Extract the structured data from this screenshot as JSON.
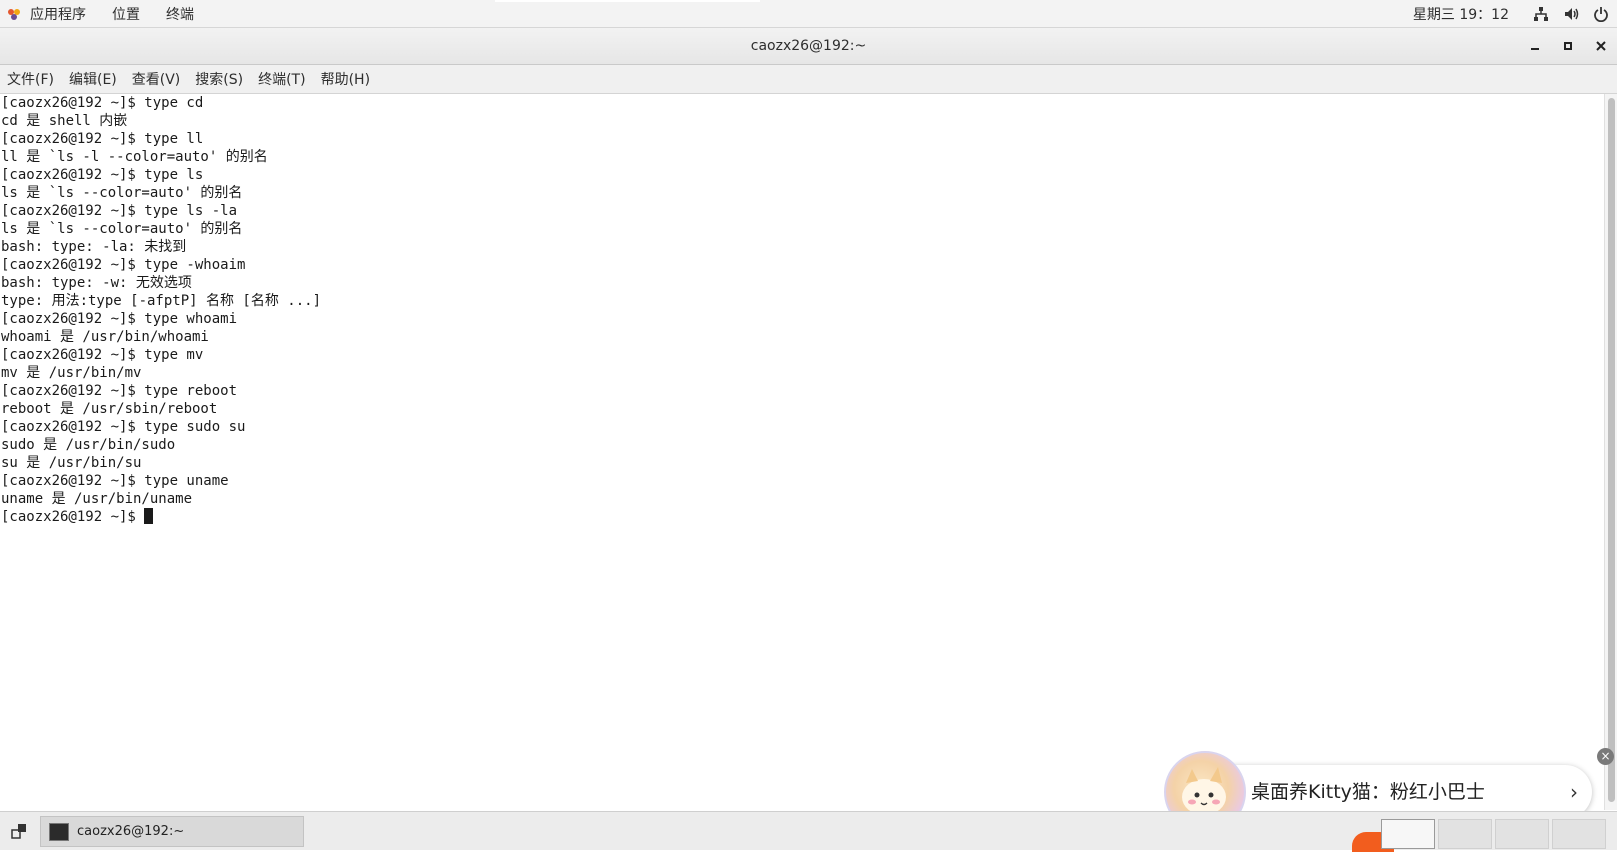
{
  "topbar": {
    "apps_label": "应用程序",
    "places_label": "位置",
    "terminal_label": "终端",
    "clock": "星期三 19：12",
    "icons": [
      "network-icon",
      "volume-icon",
      "power-icon"
    ]
  },
  "window": {
    "title": "caozx26@192:~"
  },
  "menubar": {
    "items": [
      "文件(F)",
      "编辑(E)",
      "查看(V)",
      "搜索(S)",
      "终端(T)",
      "帮助(H)"
    ]
  },
  "terminal": {
    "lines": [
      "[caozx26@192 ~]$ type cd",
      "cd 是 shell 内嵌",
      "[caozx26@192 ~]$ type ll",
      "ll 是 `ls -l --color=auto' 的别名",
      "[caozx26@192 ~]$ type ls",
      "ls 是 `ls --color=auto' 的别名",
      "[caozx26@192 ~]$ type ls -la",
      "ls 是 `ls --color=auto' 的别名",
      "bash: type: -la: 未找到",
      "[caozx26@192 ~]$ type -whoaim",
      "bash: type: -w: 无效选项",
      "type: 用法:type [-afptP] 名称 [名称 ...]",
      "[caozx26@192 ~]$ type whoami",
      "whoami 是 /usr/bin/whoami",
      "[caozx26@192 ~]$ type mv",
      "mv 是 /usr/bin/mv",
      "[caozx26@192 ~]$ type reboot",
      "reboot 是 /usr/sbin/reboot",
      "[caozx26@192 ~]$ type sudo su",
      "sudo 是 /usr/bin/sudo",
      "su 是 /usr/bin/su",
      "[caozx26@192 ~]$ type uname",
      "uname 是 /usr/bin/uname"
    ],
    "prompt": "[caozx26@192 ~]$ "
  },
  "ad": {
    "text": "桌面养Kitty猫：粉红小巴士",
    "chevron": "›",
    "close": "×"
  },
  "taskbar": {
    "task_label": "caozx26@192:~"
  }
}
